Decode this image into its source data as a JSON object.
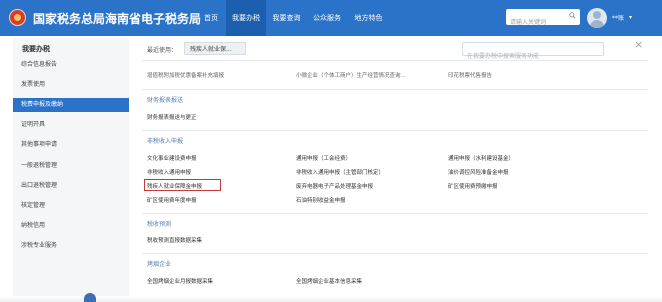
{
  "header": {
    "title": "国家税务总局海南省电子税务局",
    "nav": [
      "首页",
      "我要办税",
      "我要查询",
      "公众服务",
      "地方特色"
    ],
    "active_nav": "我要办税",
    "search_placeholder": "请输入关键词",
    "user_name": "**账",
    "caret": "▾"
  },
  "sidebar": {
    "title": "我要办税",
    "items": [
      "综合信息报告",
      "发票使用",
      "税费申报及缴纳",
      "证明开具",
      "其他事项申请",
      "一般退税管理",
      "出口退税管理",
      "核定管理",
      "纳税信用",
      "涉税专业服务"
    ],
    "active_item": "税费申报及缴纳"
  },
  "content": {
    "recent_label": "最近使用：",
    "recent_tag": "残疾人就业保...",
    "service_search_placeholder": "在我要办税中搜索服务功能",
    "close": "×",
    "top_row": [
      "增值税附加税优惠备案补充填报",
      "小微企业（个体工商户）生产经营情况查询...",
      "印花税票代售报告"
    ],
    "sections": [
      {
        "title": "财务报表报送",
        "items": [
          "财务报表报送与更正"
        ]
      },
      {
        "title": "非税收入申报",
        "items": [
          "文化事业建设费申报",
          "通用申报（工会经费）",
          "通用申报（水利建设基金）",
          "非税收入通用申报",
          "非税收入通用申报（主管部门核定）",
          "油价调控风险准备金申报",
          "残疾人就业保障金申报",
          "废弃电器电子产品处理基金申报",
          "矿区使用费预缴申报",
          "矿区使用费年度申报",
          "石油特别收益金申报"
        ]
      },
      {
        "title": "税收预测",
        "items": [
          "税收预测直报数据采集"
        ]
      },
      {
        "title": "烤烟企业",
        "items": [
          "全国烤烟企业月报数据采集",
          "全国烤烟企业基本信息采集"
        ]
      }
    ]
  }
}
